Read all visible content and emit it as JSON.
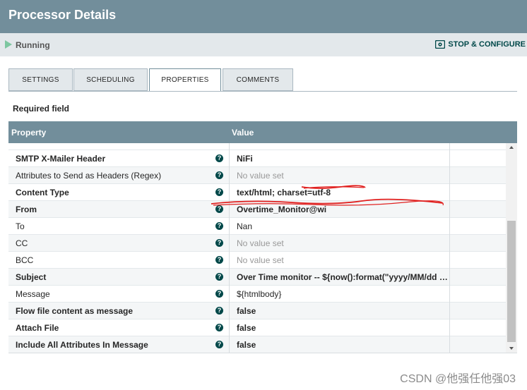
{
  "header": {
    "title": "Processor Details"
  },
  "status": {
    "state": "Running",
    "stop_configure": "STOP & CONFIGURE"
  },
  "tabs": [
    {
      "label": "SETTINGS",
      "active": false
    },
    {
      "label": "SCHEDULING",
      "active": false
    },
    {
      "label": "PROPERTIES",
      "active": true
    },
    {
      "label": "COMMENTS",
      "active": false
    }
  ],
  "required_label": "Required field",
  "grid": {
    "columns": {
      "property": "Property",
      "value": "Value"
    },
    "rows": [
      {
        "property": "SMTP X-Mailer Header",
        "value": "NiFi",
        "required": true,
        "unset": false
      },
      {
        "property": "Attributes to Send as Headers (Regex)",
        "value": "No value set",
        "required": false,
        "unset": true
      },
      {
        "property": "Content Type",
        "value": "text/html; charset=utf-8",
        "required": true,
        "unset": false
      },
      {
        "property": "From",
        "value": "Overtime_Monitor@wi",
        "required": true,
        "unset": false
      },
      {
        "property": "To",
        "value": "Nan",
        "required": false,
        "unset": false
      },
      {
        "property": "CC",
        "value": "No value set",
        "required": false,
        "unset": true
      },
      {
        "property": "BCC",
        "value": "No value set",
        "required": false,
        "unset": true
      },
      {
        "property": "Subject",
        "value": "Over Time monitor -- ${now():format(\"yyyy/MM/dd HH...",
        "required": true,
        "unset": false
      },
      {
        "property": "Message",
        "value": "${htmlbody}",
        "required": false,
        "unset": false
      },
      {
        "property": "Flow file content as message",
        "value": "false",
        "required": true,
        "unset": false
      },
      {
        "property": "Attach File",
        "value": "false",
        "required": true,
        "unset": false
      },
      {
        "property": "Include All Attributes In Message",
        "value": "false",
        "required": true,
        "unset": false
      }
    ]
  },
  "watermark": "CSDN @他强任他强03",
  "colors": {
    "header": "#728e9b",
    "accent": "#004849",
    "running": "#7dc7a0",
    "redaction": "#e0201f"
  }
}
